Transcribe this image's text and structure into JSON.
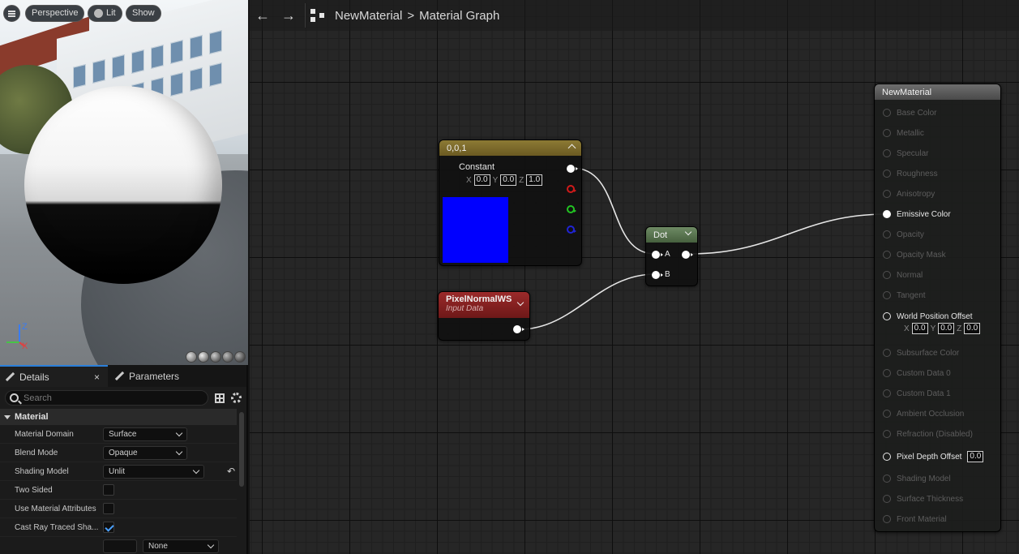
{
  "viewport": {
    "buttons": {
      "perspective": "Perspective",
      "lit": "Lit",
      "show": "Show"
    },
    "axes": {
      "z": "Z",
      "x": "X"
    }
  },
  "details": {
    "tabs": {
      "details": "Details",
      "parameters": "Parameters",
      "close": "×"
    },
    "search_placeholder": "Search",
    "section": "Material",
    "props": [
      {
        "name": "Material Domain",
        "value": "Surface"
      },
      {
        "name": "Blend Mode",
        "value": "Opaque"
      },
      {
        "name": "Shading Model",
        "value": "Unlit"
      },
      {
        "name": "Two Sided",
        "checked": false
      },
      {
        "name": "Use Material Attributes",
        "checked": false
      },
      {
        "name": "Cast Ray Traced Sha...",
        "checked": true
      },
      {
        "name": "",
        "value": "None"
      }
    ]
  },
  "graph": {
    "breadcrumb": {
      "asset": "NewMaterial",
      "separator": ">",
      "graph": "Material Graph"
    },
    "constant_node": {
      "title": "0,0,1",
      "label": "Constant",
      "x_label": "X",
      "x": "0.0",
      "y_label": "Y",
      "y": "0.0",
      "z_label": "Z",
      "z": "1.0",
      "swatch_color": "#0000ff"
    },
    "pixel_node": {
      "title": "PixelNormalWS",
      "subtitle": "Input Data"
    },
    "dot_node": {
      "title": "Dot",
      "pin_a": "A",
      "pin_b": "B"
    },
    "result_node": {
      "title": "NewMaterial",
      "pins": [
        {
          "label": "Base Color",
          "active": false
        },
        {
          "label": "Metallic",
          "active": false
        },
        {
          "label": "Specular",
          "active": false
        },
        {
          "label": "Roughness",
          "active": false
        },
        {
          "label": "Anisotropy",
          "active": false
        },
        {
          "label": "Emissive Color",
          "active": true,
          "connected": true
        },
        {
          "label": "Opacity",
          "active": false
        },
        {
          "label": "Opacity Mask",
          "active": false
        },
        {
          "label": "Normal",
          "active": false
        },
        {
          "label": "Tangent",
          "active": false
        },
        {
          "label": "World Position Offset",
          "active": true
        },
        {
          "label": "Subsurface Color",
          "active": false
        },
        {
          "label": "Custom Data 0",
          "active": false
        },
        {
          "label": "Custom Data 1",
          "active": false
        },
        {
          "label": "Ambient Occlusion",
          "active": false
        },
        {
          "label": "Refraction (Disabled)",
          "active": false
        },
        {
          "label": "Pixel Depth Offset",
          "active": true
        },
        {
          "label": "Shading Model",
          "active": false
        },
        {
          "label": "Surface Thickness",
          "active": false
        },
        {
          "label": "Front Material",
          "active": false
        }
      ],
      "wpo": {
        "x_label": "X",
        "x": "0.0",
        "y_label": "Y",
        "y": "0.0",
        "z_label": "Z",
        "z": "0.0"
      },
      "pdo_value": "0.0"
    }
  }
}
